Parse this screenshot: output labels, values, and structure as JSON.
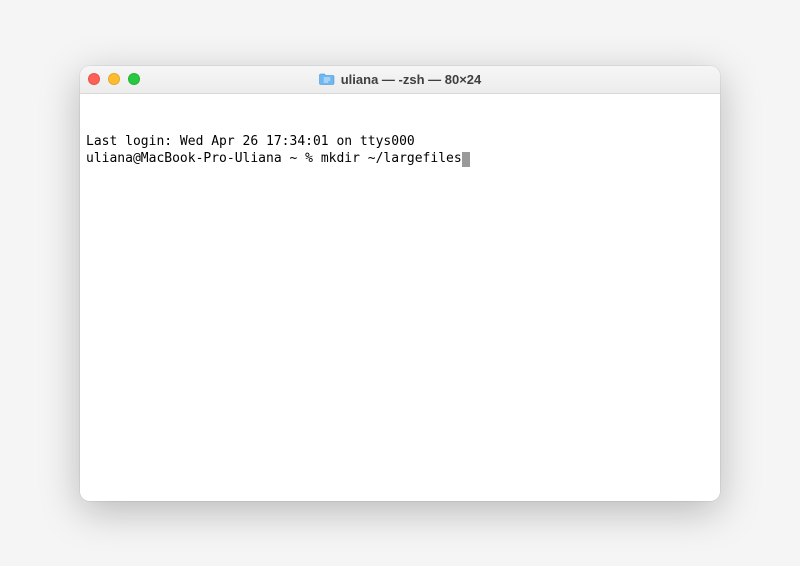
{
  "titlebar": {
    "title": "uliana — -zsh — 80×24"
  },
  "terminal": {
    "last_login": "Last login: Wed Apr 26 17:34:01 on ttys000",
    "prompt": "uliana@MacBook-Pro-Uliana ~ % ",
    "command": "mkdir ~/largefiles"
  }
}
